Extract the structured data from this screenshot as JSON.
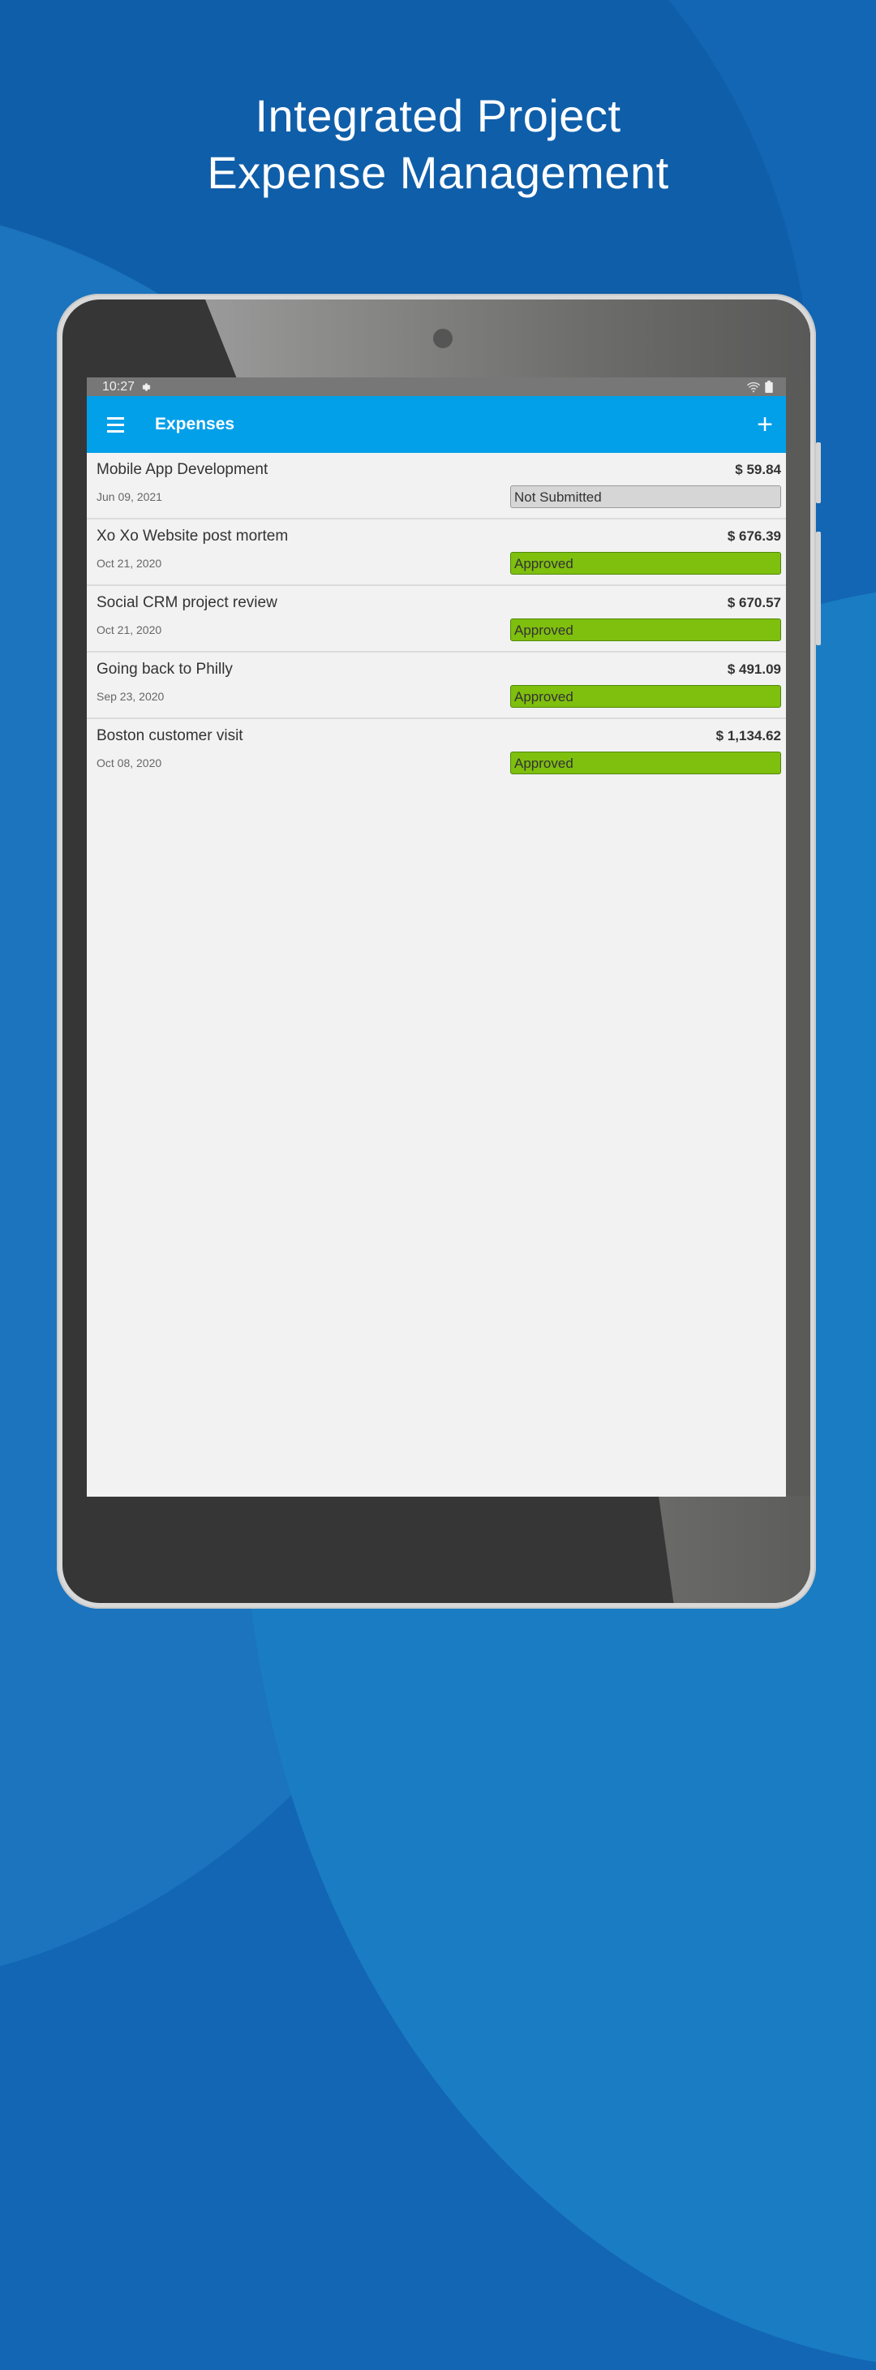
{
  "headline": {
    "line1": "Integrated Project",
    "line2": "Expense Management"
  },
  "status_bar": {
    "time": "10:27",
    "icons": [
      "settings-gear-icon",
      "wifi-icon",
      "battery-icon"
    ]
  },
  "app_bar": {
    "title": "Expenses",
    "menu_icon": "hamburger-menu-icon",
    "add_icon": "plus-icon",
    "add_label": "+"
  },
  "colors": {
    "app_bar": "#03a0ea",
    "approved": "#7fbf0e",
    "not_submitted": "#d6d6d6",
    "background": "#1266b4"
  },
  "expenses": [
    {
      "name": "Mobile App Development",
      "amount": "$ 59.84",
      "date": "Jun 09, 2021",
      "status": "Not Submitted"
    },
    {
      "name": "Xo Xo Website post mortem",
      "amount": "$ 676.39",
      "date": "Oct 21, 2020",
      "status": "Approved"
    },
    {
      "name": "Social CRM project review",
      "amount": "$ 670.57",
      "date": "Oct 21, 2020",
      "status": "Approved"
    },
    {
      "name": "Going back to Philly",
      "amount": "$ 491.09",
      "date": "Sep 23, 2020",
      "status": "Approved"
    },
    {
      "name": "Boston customer visit",
      "amount": "$ 1,134.62",
      "date": "Oct 08, 2020",
      "status": "Approved"
    }
  ]
}
